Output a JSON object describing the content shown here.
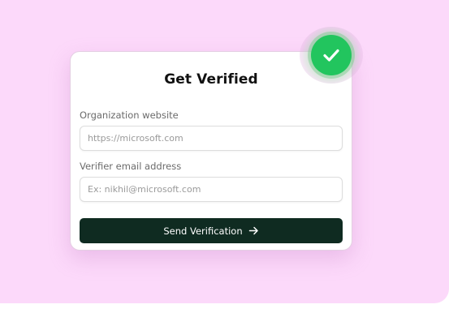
{
  "form": {
    "title": "Get Verified",
    "website_label": "Organization website",
    "website_placeholder": "https://microsoft.com",
    "email_label": "Verifier email address",
    "email_placeholder": "Ex: nikhil@microsoft.com",
    "submit_label": "Send Verification",
    "submit_icon": "arrow-right-icon"
  },
  "badge": {
    "icon": "checkmark-icon",
    "color": "#22c55e"
  },
  "colors": {
    "background": "#fcd9fa",
    "button": "#0f2b21",
    "accent": "#22c55e"
  }
}
